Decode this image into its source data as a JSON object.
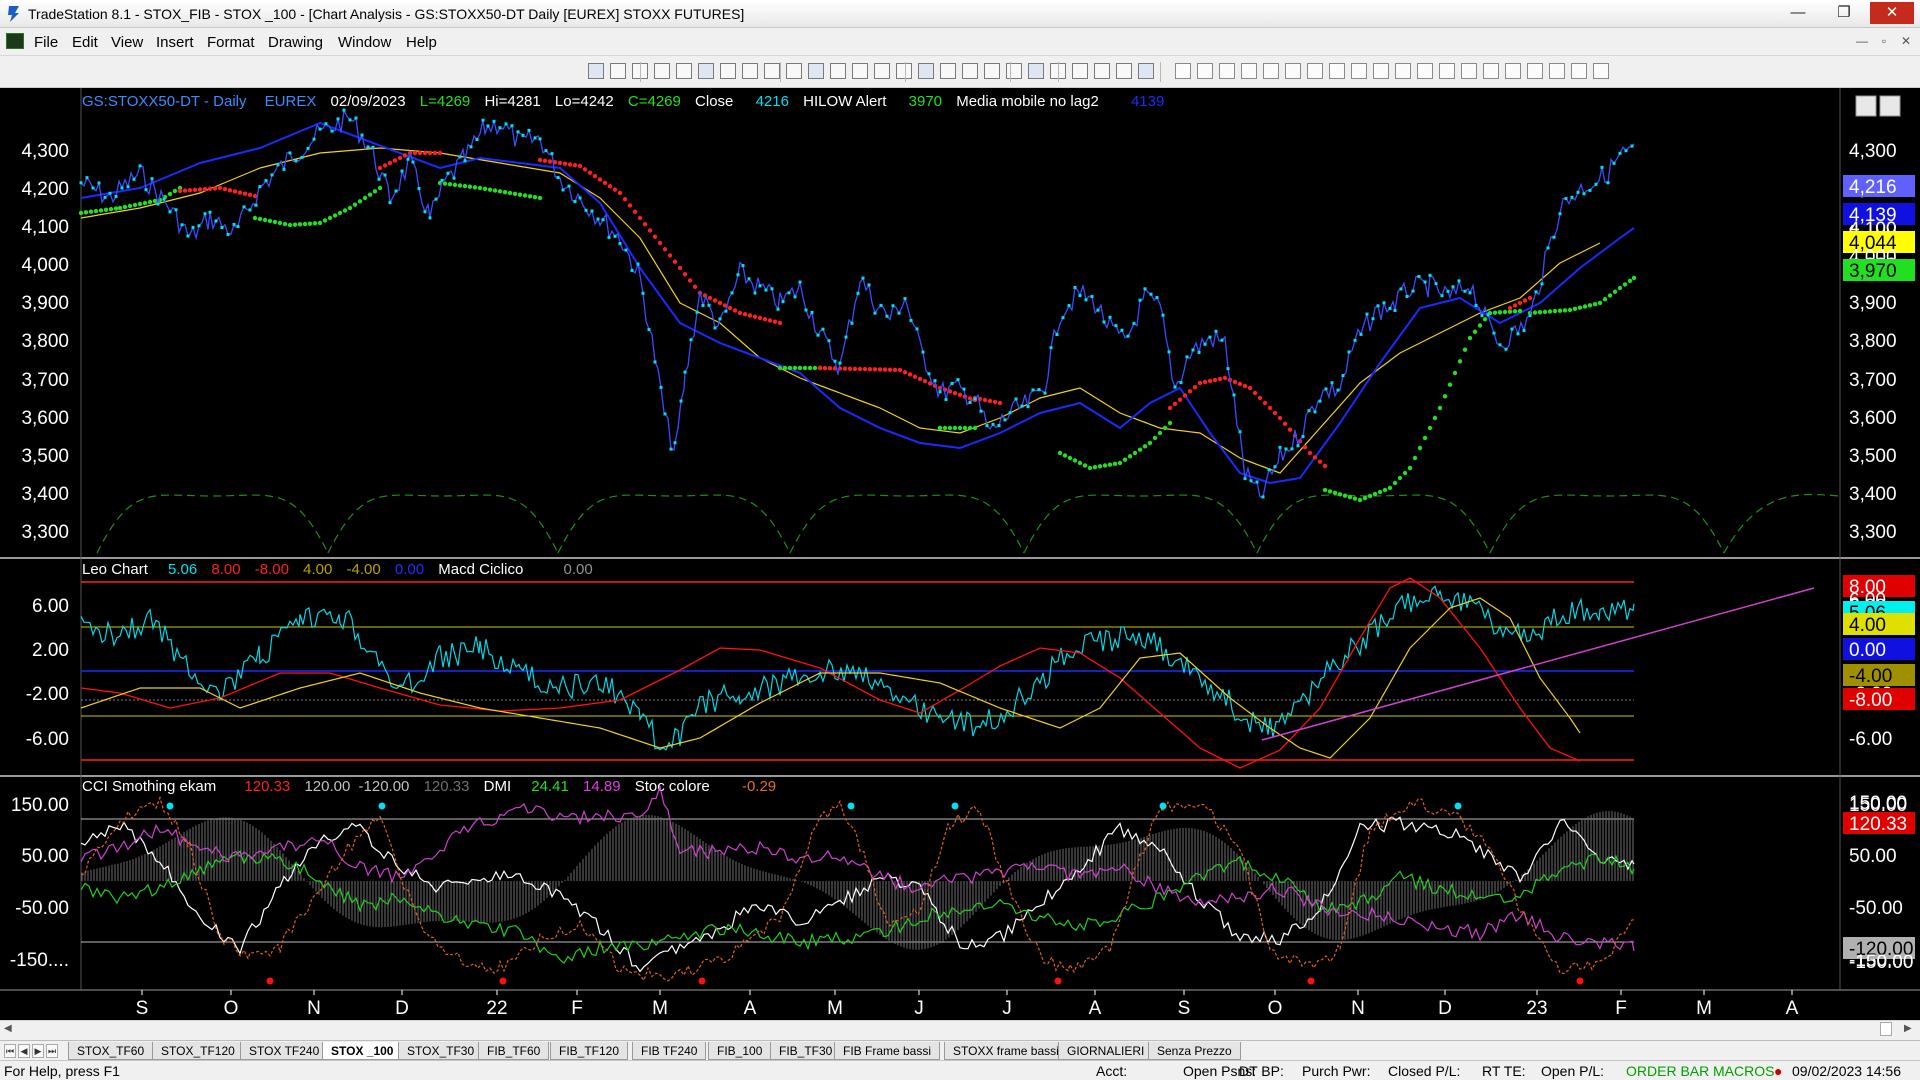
{
  "window": {
    "title": "TradeStation 8.1 - STOX_FIB - STOX _100 - [Chart Analysis - GS:STOXX50-DT  Daily  [EUREX] STOXX FUTURES]",
    "minimize": "—",
    "maximize": "❐",
    "close": "✕"
  },
  "menu": [
    "File",
    "Edit",
    "View",
    "Insert",
    "Format",
    "Drawing",
    "Window",
    "Help"
  ],
  "chart": {
    "symbol": "GS:STOXX50-DT - Daily",
    "exchange": "EUREX",
    "date": "02/09/2023",
    "last": "L=4269",
    "high": "Hi=4281",
    "low": "Lo=4242",
    "close_eq": "C=4269",
    "close_label": "Close",
    "close_value": "4216",
    "hilow_label": "HILOW Alert",
    "hilow_value": "3970",
    "ma_label": "Media mobile no lag2",
    "ma_value": "4139",
    "x_labels": [
      "S",
      "O",
      "N",
      "D",
      "22",
      "F",
      "M",
      "A",
      "M",
      "J",
      "J",
      "A",
      "S",
      "O",
      "N",
      "D",
      "23",
      "F",
      "M",
      "A"
    ],
    "colors": {
      "price": "#00d8e8",
      "ma_blue": "#1a2bff",
      "ma_yellow": "#f0d020",
      "hilow_red": "#ff2020",
      "hilow_green": "#20e020",
      "magenta": "#e040e0",
      "grid_text": "#ffffff"
    }
  },
  "price_panel": {
    "axis": [
      "4,300",
      "4,200",
      "4,100",
      "4,000",
      "3,900",
      "3,800",
      "3,700",
      "3,600",
      "3,500",
      "3,400",
      "3,300"
    ],
    "tags": [
      {
        "text": "4,216",
        "bg": "#6060ff",
        "fg": "#ffffff"
      },
      {
        "text": "4,139",
        "bg": "#1010e0",
        "fg": "#ffffff"
      },
      {
        "text": "4,100",
        "bg": "#000000",
        "fg": "#ffffff"
      },
      {
        "text": "4,044",
        "bg": "#ffff00",
        "fg": "#000000"
      },
      {
        "text": "4,000",
        "bg": "#000000",
        "fg": "#ffffff"
      },
      {
        "text": "3,970",
        "bg": "#20e020",
        "fg": "#000000"
      }
    ]
  },
  "leo_panel": {
    "name": "Leo Chart",
    "v1": "5.06",
    "v2": "8.00",
    "v3": "-8.00",
    "v4": "4.00",
    "v5": "-4.00",
    "v6": "0.00",
    "macd_label": "Macd Ciclico",
    "macd_value": "0.00",
    "axis": [
      "6.00",
      "2.00",
      "-2.00",
      "-6.00"
    ],
    "tags": [
      {
        "text": "8.00",
        "bg": "#e00000",
        "fg": "#ffffff"
      },
      {
        "text": "6.00",
        "bg": "#000000",
        "fg": "#ffffff"
      },
      {
        "text": "5.06",
        "bg": "#00f0f0",
        "fg": "#000000"
      },
      {
        "text": "4.00",
        "bg": "#e0e000",
        "fg": "#000000"
      },
      {
        "text": "0.00",
        "bg": "#1010e0",
        "fg": "#ffffff"
      },
      {
        "text": "-4.00",
        "bg": "#a09000",
        "fg": "#000000"
      },
      {
        "text": "-8.00",
        "bg": "#e00000",
        "fg": "#ffffff"
      }
    ]
  },
  "cci_panel": {
    "name": "CCI Smothing ekam",
    "v1": "120.33",
    "v2": "120.00",
    "v3": "-120.00",
    "v4": "120.33",
    "dmi_label": "DMI",
    "dmi_v1": "24.41",
    "dmi_v2": "14.89",
    "stoc_label": "Stoc colore",
    "stoc_value": "-0.29",
    "axis": [
      "150.00",
      "50.00",
      "-50.00",
      "-150...."
    ],
    "tags": [
      {
        "text": "150.00",
        "bg": "#000000",
        "fg": "#ffffff"
      },
      {
        "text": "120.33",
        "bg": "#e00000",
        "fg": "#ffffff"
      },
      {
        "text": "-120.00",
        "bg": "#b0b0b0",
        "fg": "#000000"
      },
      {
        "text": "-150.00",
        "bg": "#000000",
        "fg": "#ffffff"
      }
    ]
  },
  "tabs": [
    "STOX_TF60",
    "STOX_TF120",
    "STOX TF240",
    "STOX _100",
    "STOX_TF30",
    "FIB_TF60",
    "FIB_TF120",
    "FIB TF240",
    "FIB_100",
    "FIB_TF30",
    "FIB Frame bassi",
    "STOXX frame bassi",
    "GIORNALIERI",
    "Senza Prezzo"
  ],
  "active_tab": "STOX _100",
  "status": {
    "help": "For Help, press F1",
    "acct": "Acct:",
    "open_psns": "Open Psns:",
    "dt_bp": "DT BP:",
    "purch_pwr": "Purch Pwr:",
    "closed_pl": "Closed P/L:",
    "rt_te": "RT TE:",
    "open_pl": "Open P/L:",
    "order_bar": "ORDER BAR",
    "macros": "MACROS",
    "datetime": "09/02/2023 14:56"
  }
}
